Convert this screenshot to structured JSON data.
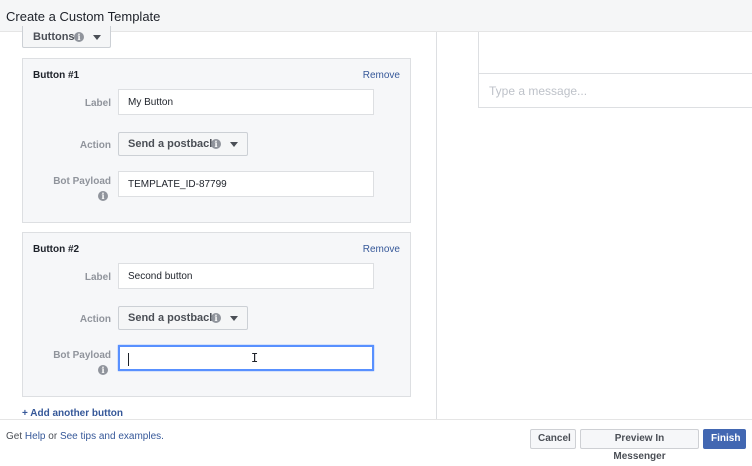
{
  "window": {
    "title": "Create a Custom Template"
  },
  "template_type": {
    "value": "Buttons"
  },
  "buttons": [
    {
      "title": "Button #1",
      "remove_label": "Remove",
      "label_caption": "Label",
      "label_value": "My Button",
      "action_caption": "Action",
      "action_value": "Send a postback",
      "payload_caption": "Bot Payload",
      "payload_value": "TEMPLATE_ID-87799"
    },
    {
      "title": "Button #2",
      "remove_label": "Remove",
      "label_caption": "Label",
      "label_value": "Second button",
      "action_caption": "Action",
      "action_value": "Send a postback",
      "payload_caption": "Bot Payload",
      "payload_value": ""
    }
  ],
  "add_button_label": "+ Add another button",
  "preview": {
    "message_placeholder": "Type a message..."
  },
  "footer": {
    "get": "Get",
    "help_link": "Help",
    "or": "or",
    "tips_link": "See tips and examples.",
    "cancel": "Cancel",
    "preview_messenger": "Preview In Messenger",
    "finish": "Finish"
  },
  "icons": {
    "info": "info-icon",
    "dropdown": "chevron-down-icon",
    "text_cursor": "i-beam-cursor-icon"
  },
  "colors": {
    "link": "#365899",
    "primary_button": "#4267b2",
    "focus_border": "#5890ff"
  }
}
